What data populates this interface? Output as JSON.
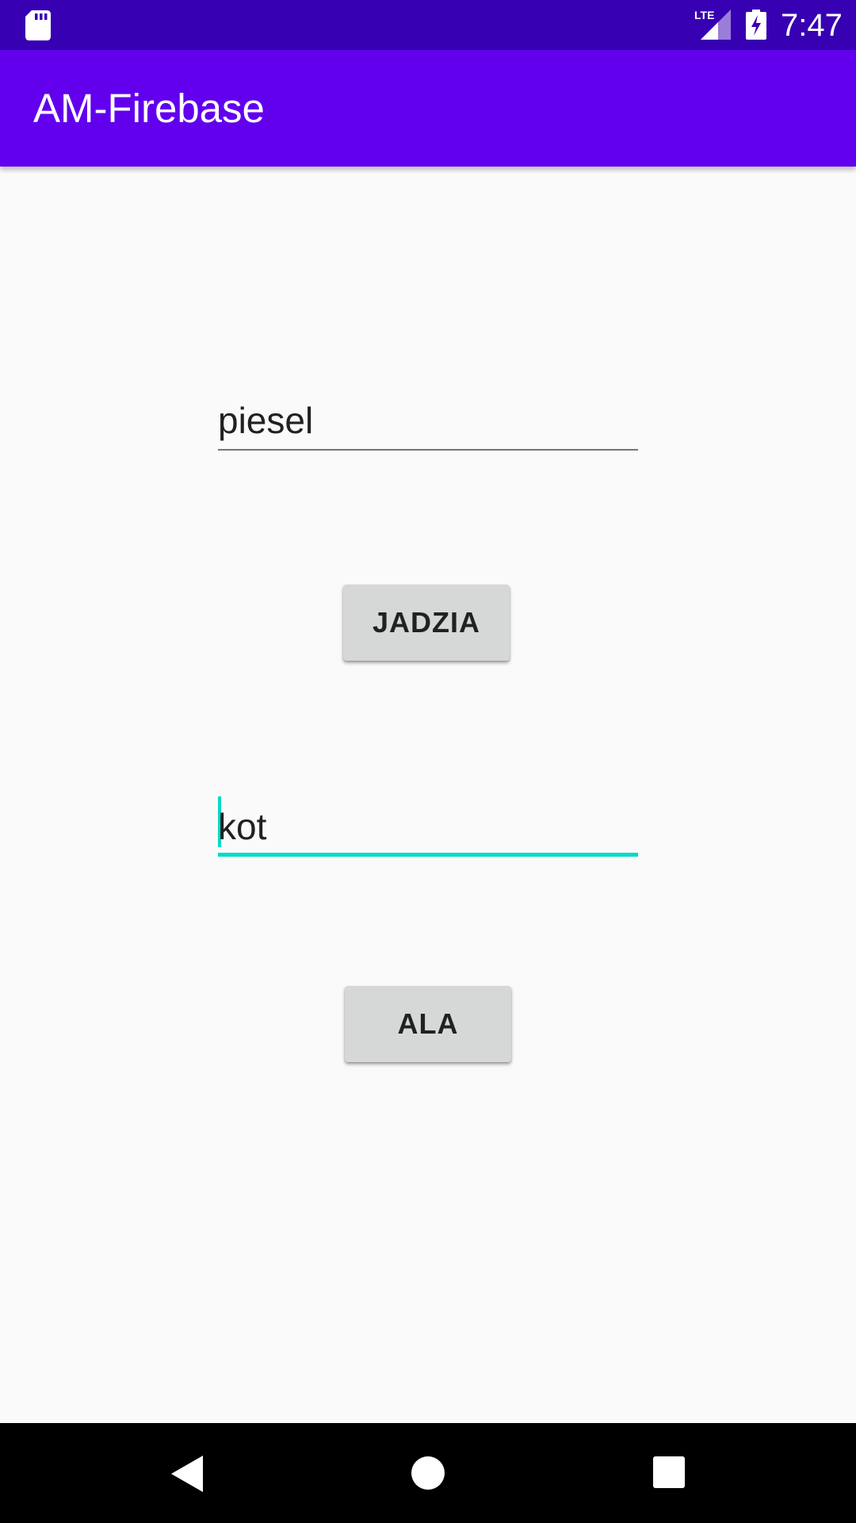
{
  "status_bar": {
    "time": "7:47",
    "network_label": "LTE",
    "icons": [
      "sd-card-icon",
      "lte-signal-icon",
      "battery-charging-icon"
    ]
  },
  "app_bar": {
    "title": "AM-Firebase"
  },
  "form": {
    "field1": {
      "value": "piesel"
    },
    "button1": {
      "label": "JADZIA"
    },
    "field2": {
      "value": "kot",
      "focused": true
    },
    "button2": {
      "label": "ALA"
    }
  },
  "nav_bar": {
    "icons": [
      "back-icon",
      "home-icon",
      "recents-icon"
    ]
  },
  "colors": {
    "status_bar": "#3700b3",
    "app_bar": "#6200ee",
    "accent": "#03dac5",
    "background": "#fafafa",
    "button": "#d6d7d7",
    "nav_bar": "#000000"
  }
}
